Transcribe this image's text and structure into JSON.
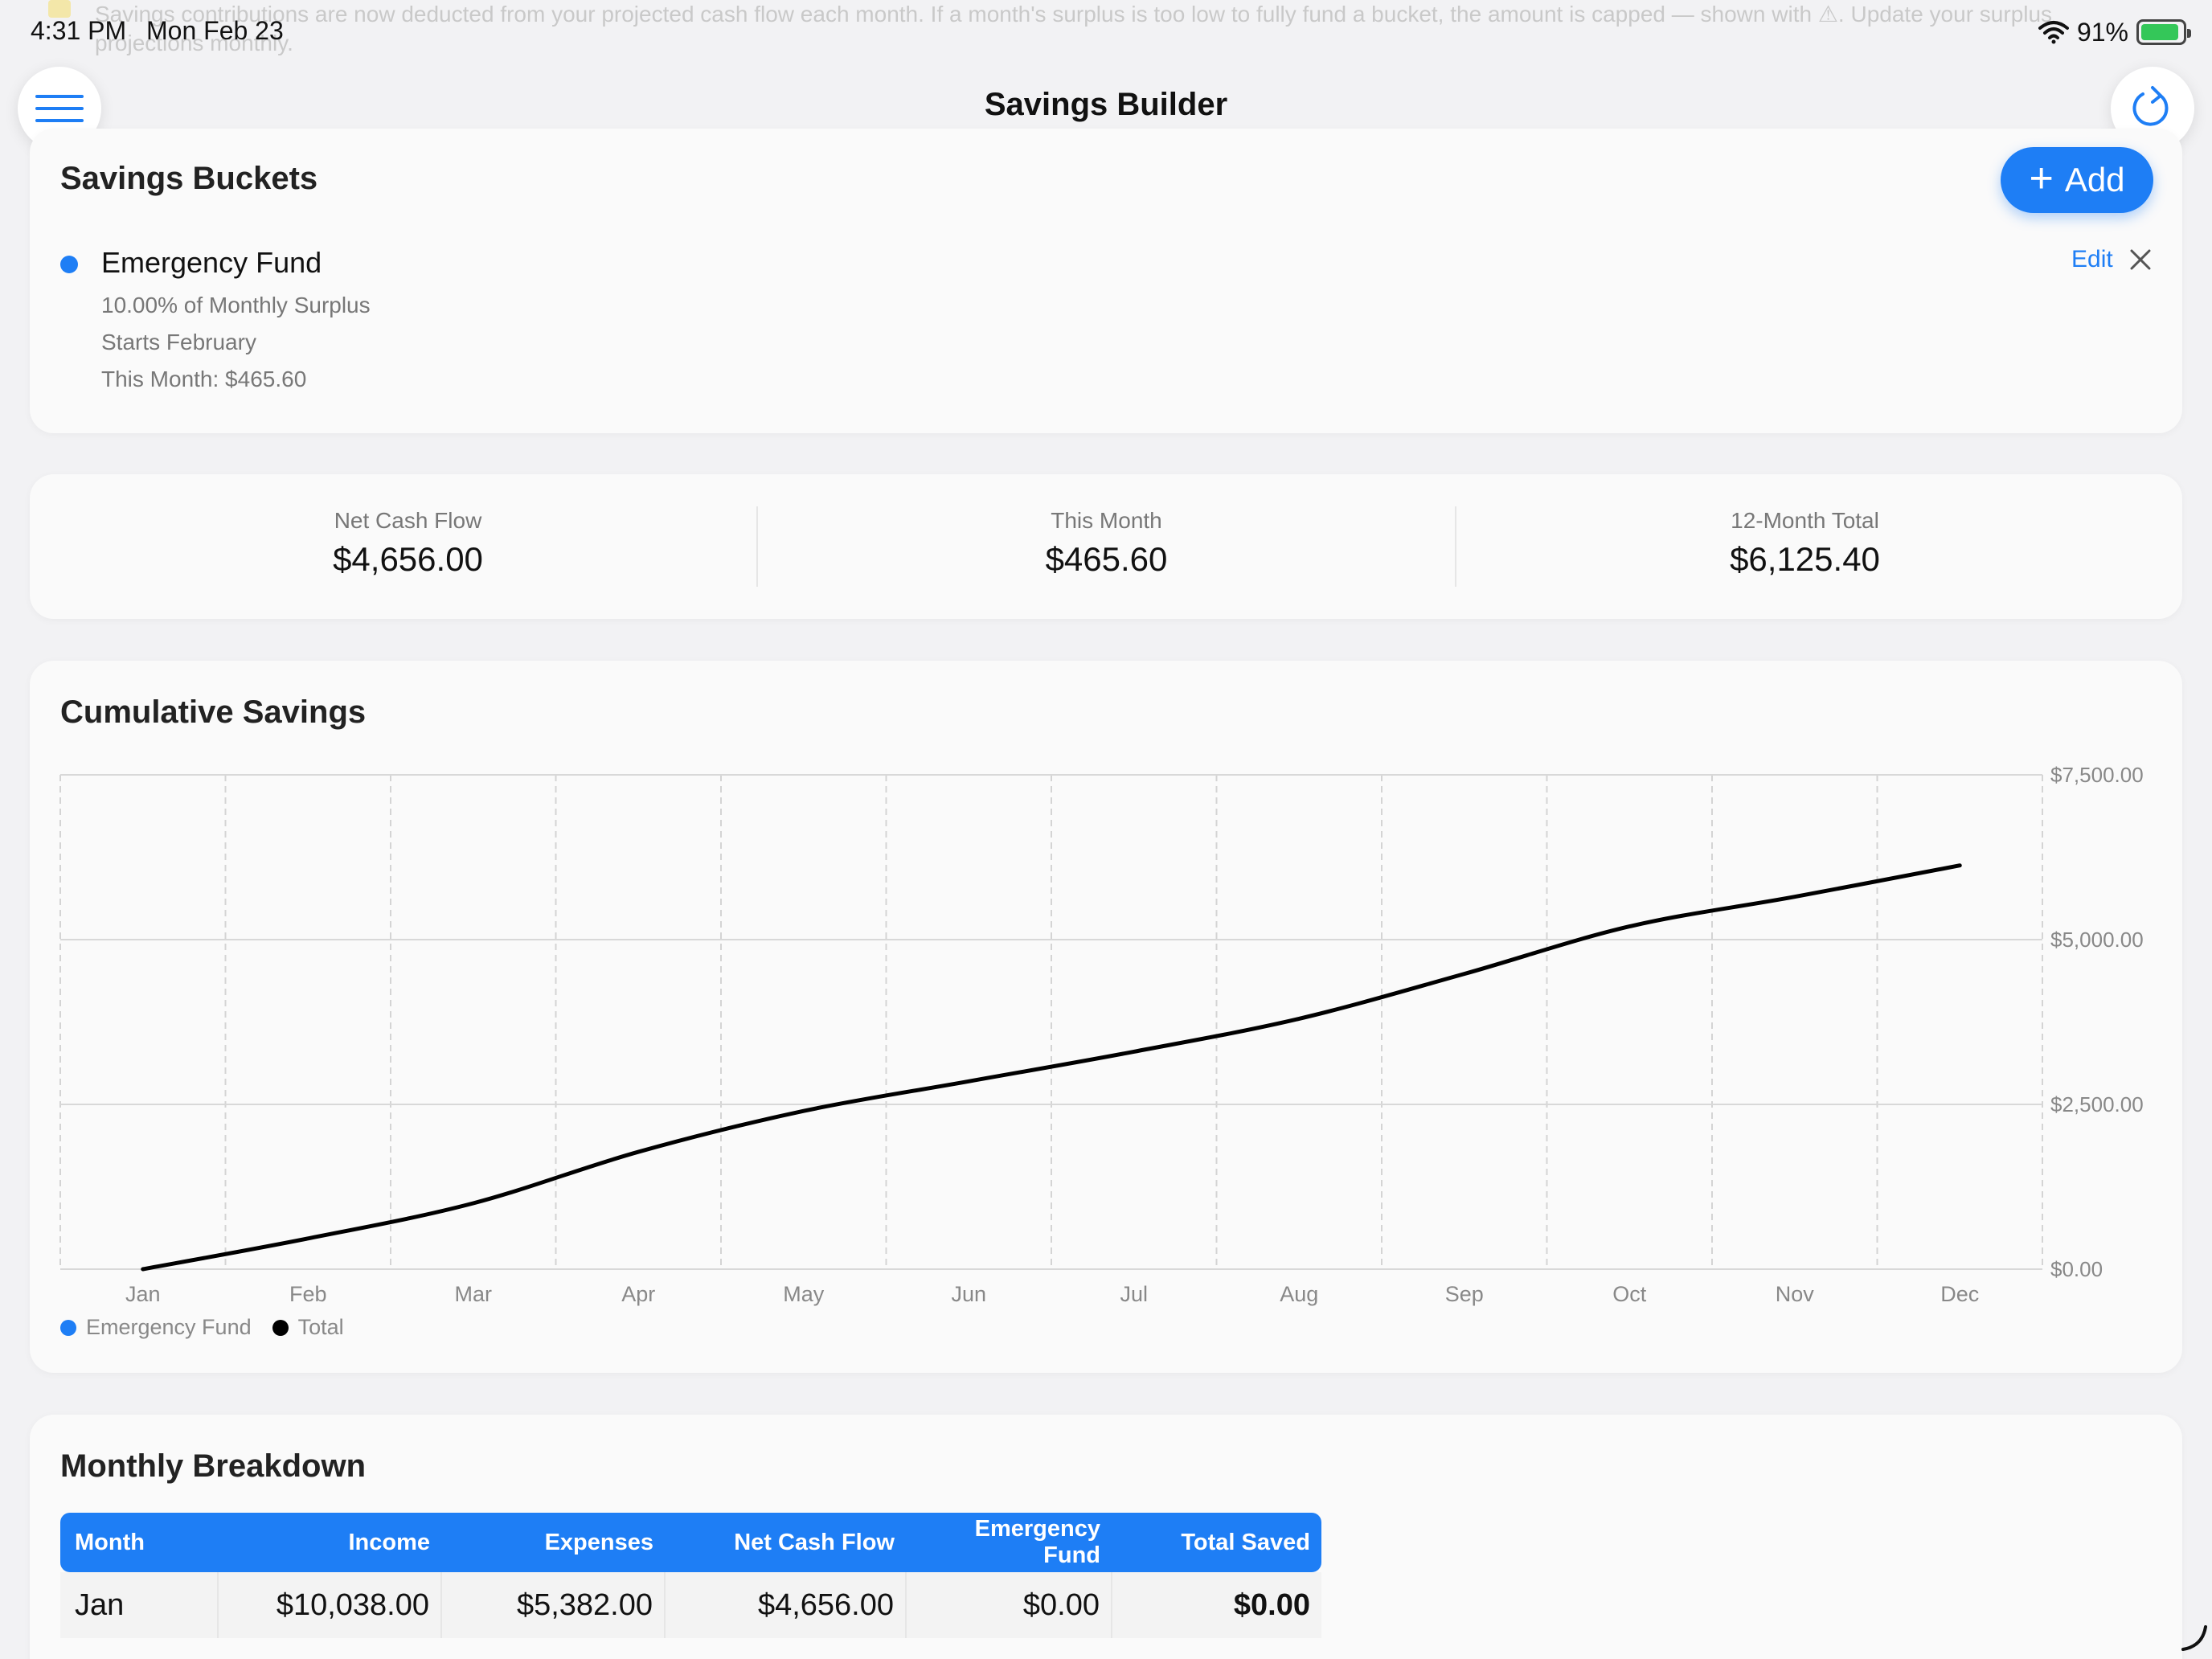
{
  "status_bar": {
    "time": "4:31 PM",
    "date": "Mon Feb 23",
    "battery_percent": "91%",
    "battery_level": 0.91
  },
  "banner": {
    "text": "Savings contributions are now deducted from your projected cash flow each month. If a month's surplus is too low to fully fund a bucket, the amount is capped — shown with ⚠. Update your surplus projections monthly."
  },
  "nav": {
    "title": "Savings Builder",
    "menu_icon": "hamburger-icon",
    "refresh_icon": "refresh-icon"
  },
  "buckets": {
    "title": "Savings Buckets",
    "add_label": "Add",
    "items": [
      {
        "name": "Emergency Fund",
        "color": "#1e7ef5",
        "percent_line": "10.00% of Monthly Surplus",
        "start_line": "Starts February",
        "this_month_line": "This Month: $465.60",
        "edit_label": "Edit"
      }
    ]
  },
  "stats": [
    {
      "label": "Net Cash Flow",
      "value": "$4,656.00"
    },
    {
      "label": "This Month",
      "value": "$465.60"
    },
    {
      "label": "12-Month Total",
      "value": "$6,125.40"
    }
  ],
  "chart_data": {
    "type": "line",
    "title": "Cumulative Savings",
    "x": [
      "Jan",
      "Feb",
      "Mar",
      "Apr",
      "May",
      "Jun",
      "Jul",
      "Aug",
      "Sep",
      "Oct",
      "Nov",
      "Dec"
    ],
    "y_tick_labels": [
      "$0.00",
      "$2,500.00",
      "$5,000.00",
      "$7,500.00"
    ],
    "ylim": [
      0,
      7500
    ],
    "grid": true,
    "y_axis_position": "right",
    "legend_position": "bottom-left",
    "series": [
      {
        "name": "Emergency Fund",
        "color": "#1e7ef5",
        "values": []
      },
      {
        "name": "Total",
        "color": "#000000",
        "values": [
          0,
          465.6,
          1000,
          1780,
          2400,
          2850,
          3300,
          3800,
          4480,
          5200,
          5650,
          6125.4
        ]
      }
    ]
  },
  "breakdown": {
    "title": "Monthly Breakdown",
    "columns": [
      "Month",
      "Income",
      "Expenses",
      "Net Cash Flow",
      "Emergency Fund",
      "Total Saved"
    ],
    "rows": [
      [
        "Jan",
        "$10,038.00",
        "$5,382.00",
        "$4,656.00",
        "$0.00",
        "$0.00"
      ]
    ]
  }
}
